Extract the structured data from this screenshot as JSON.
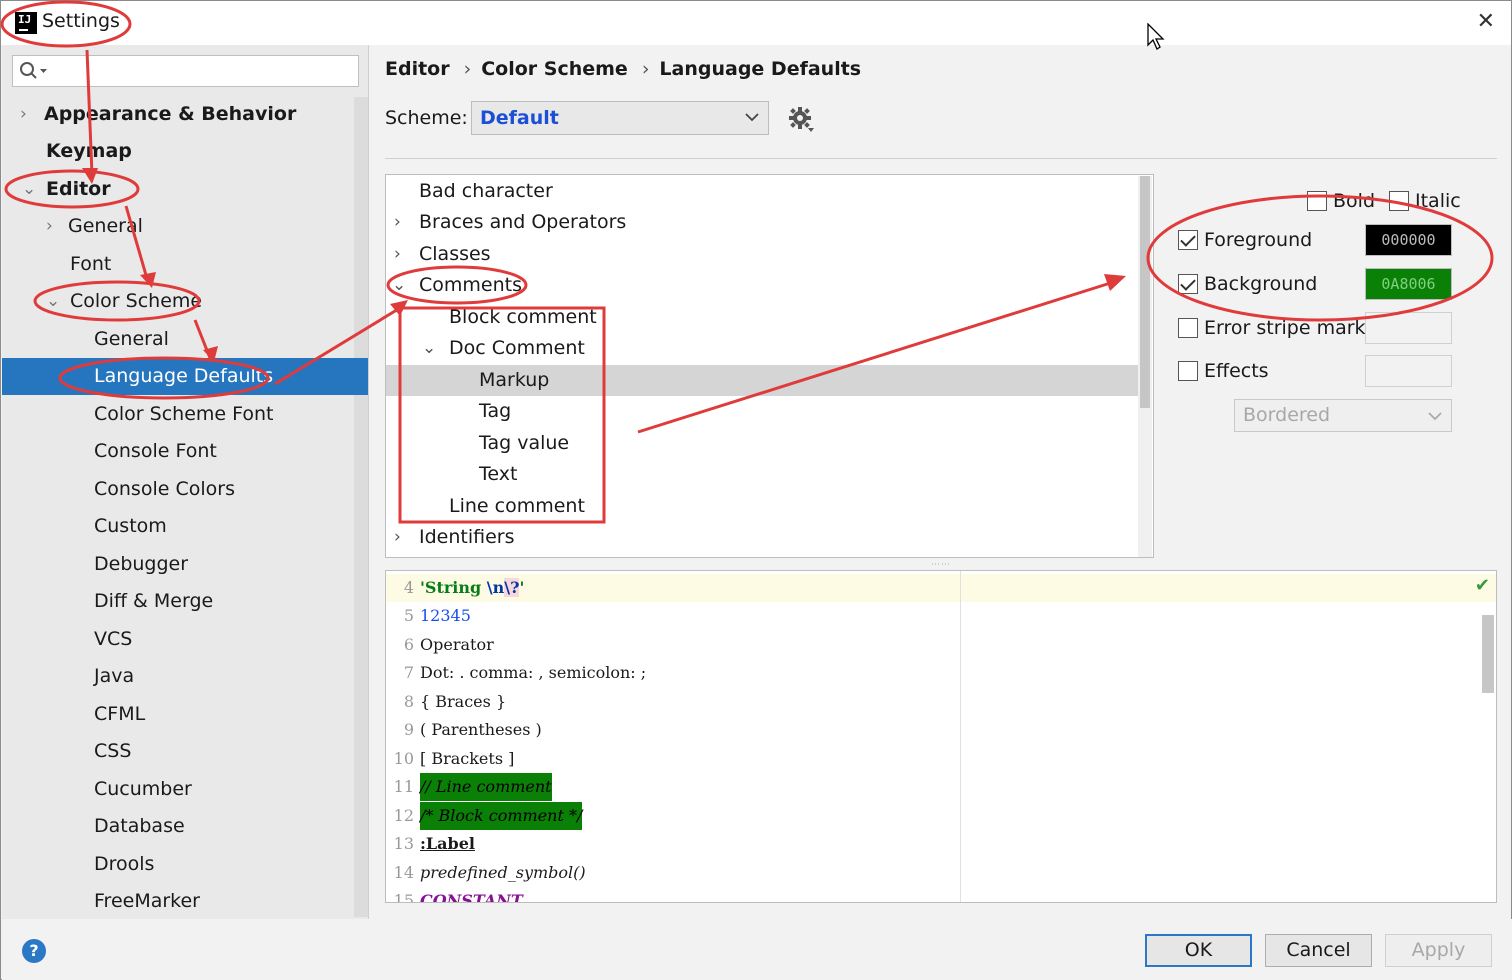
{
  "window": {
    "title": "Settings"
  },
  "search": {
    "placeholder": ""
  },
  "sidebar": {
    "items": [
      {
        "label": "Appearance & Behavior"
      },
      {
        "label": "Keymap"
      },
      {
        "label": "Editor"
      },
      {
        "label": "General"
      },
      {
        "label": "Font"
      },
      {
        "label": "Color Scheme"
      },
      {
        "label": "General"
      },
      {
        "label": "Language Defaults"
      },
      {
        "label": "Color Scheme Font"
      },
      {
        "label": "Console Font"
      },
      {
        "label": "Console Colors"
      },
      {
        "label": "Custom"
      },
      {
        "label": "Debugger"
      },
      {
        "label": "Diff & Merge"
      },
      {
        "label": "VCS"
      },
      {
        "label": "Java"
      },
      {
        "label": "CFML"
      },
      {
        "label": "CSS"
      },
      {
        "label": "Cucumber"
      },
      {
        "label": "Database"
      },
      {
        "label": "Drools"
      },
      {
        "label": "FreeMarker"
      }
    ]
  },
  "breadcrumb": {
    "items": [
      "Editor",
      "Color Scheme",
      "Language Defaults"
    ]
  },
  "scheme": {
    "label": "Scheme:",
    "value": "Default"
  },
  "elements": {
    "items": [
      {
        "label": "Bad character"
      },
      {
        "label": "Braces and Operators"
      },
      {
        "label": "Classes"
      },
      {
        "label": "Comments"
      },
      {
        "label": "Block comment"
      },
      {
        "label": "Doc Comment"
      },
      {
        "label": "Markup"
      },
      {
        "label": "Tag"
      },
      {
        "label": "Tag value"
      },
      {
        "label": "Text"
      },
      {
        "label": "Line comment"
      },
      {
        "label": "Identifiers"
      }
    ]
  },
  "attributes": {
    "bold_label": "Bold",
    "italic_label": "Italic",
    "foreground_label": "Foreground",
    "foreground_value": "000000",
    "foreground_color": "#000000",
    "background_label": "Background",
    "background_value": "0A8006",
    "background_color": "#0A8006",
    "error_stripe_label": "Error stripe mark",
    "effects_label": "Effects",
    "effects_type": "Bordered"
  },
  "preview": {
    "lines": [
      {
        "n": "4",
        "segments": [
          "'String",
          "\\n",
          "\\?",
          "'"
        ]
      },
      {
        "n": "5",
        "text": "12345"
      },
      {
        "n": "6",
        "text": "Operator"
      },
      {
        "n": "7",
        "text": "Dot: . comma: , semicolon: ;"
      },
      {
        "n": "8",
        "text": "{ Braces }"
      },
      {
        "n": "9",
        "text": "( Parentheses )"
      },
      {
        "n": "10",
        "text": "[ Brackets ]"
      },
      {
        "n": "11",
        "text": "// Line comment"
      },
      {
        "n": "12",
        "text": "/* Block comment */"
      },
      {
        "n": "13",
        "text": ":Label"
      },
      {
        "n": "14",
        "text": "predefined_symbol()"
      },
      {
        "n": "15",
        "text": "CONSTANT"
      }
    ]
  },
  "buttons": {
    "ok": "OK",
    "cancel": "Cancel",
    "apply": "Apply",
    "help": "?"
  },
  "colors": {
    "selection": "#2675bf",
    "annotation": "#e03b3b",
    "link": "#1a4fd6"
  }
}
